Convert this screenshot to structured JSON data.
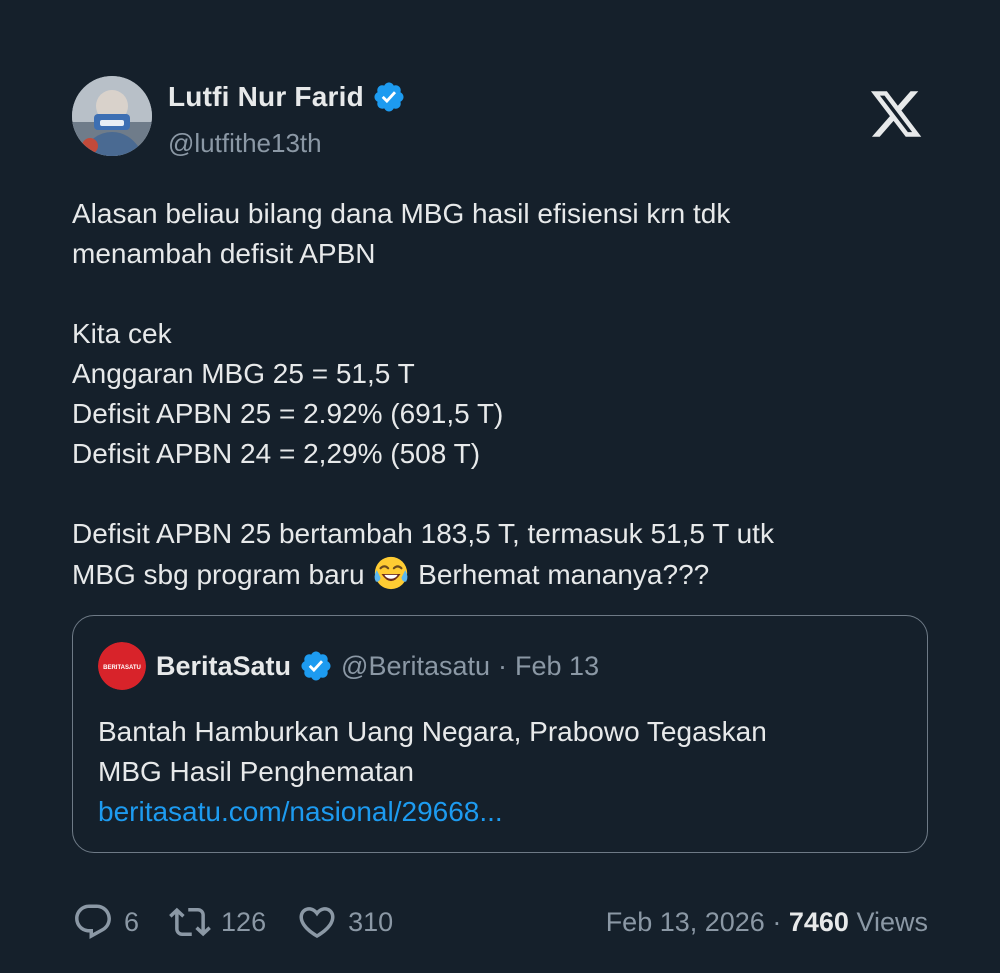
{
  "author": {
    "display_name": "Lutfi Nur Farid",
    "handle": "@lutfithe13th"
  },
  "icons": {
    "verified": "verified-badge-icon",
    "platform_logo": "x-logo-icon",
    "emoji": "face-with-tears-of-joy"
  },
  "colors": {
    "background": "#15202b",
    "text": "#e7e9ea",
    "muted": "#8b98a5",
    "link": "#1d9bf0",
    "verified": "#1d9bf0",
    "berita_red": "#d8232a"
  },
  "tweet": {
    "lines": [
      "Alasan beliau bilang dana MBG hasil efisiensi krn tdk",
      "menambah defisit APBN",
      "",
      "Kita cek",
      "Anggaran MBG 25 = 51,5 T",
      "Defisit APBN 25 = 2.92% (691,5 T)",
      "Defisit APBN 24 = 2,29% (508 T)",
      "",
      "Defisit APBN 25 bertambah 183,5 T, termasuk 51,5 T utk"
    ],
    "last_line_before_emoji": "MBG sbg program baru",
    "last_line_after_emoji": "Berhemat mananya???"
  },
  "quote": {
    "logo_text": "BERITASATU",
    "name": "BeritaSatu",
    "handle": "@Beritasatu",
    "separator": "·",
    "date": "Feb 13",
    "text_lines": [
      "Bantah Hamburkan Uang Negara, Prabowo Tegaskan",
      "MBG Hasil Penghematan"
    ],
    "link": "beritasatu.com/nasional/29668..."
  },
  "footer": {
    "replies": "6",
    "retweets": "126",
    "likes": "310",
    "date": "Feb 13, 2026",
    "separator": "·",
    "views_count": "7460",
    "views_label": "Views"
  }
}
